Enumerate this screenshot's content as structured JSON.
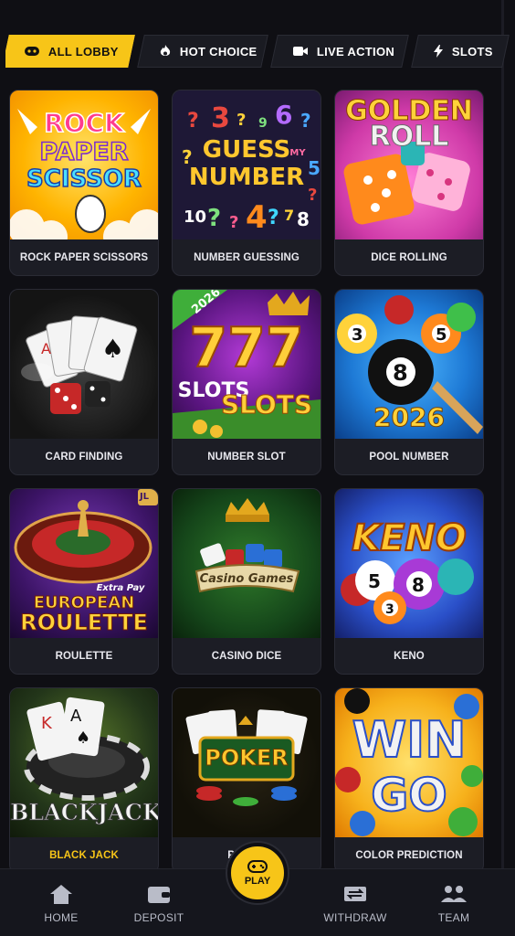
{
  "tabs": [
    {
      "label": "ALL LOBBY",
      "icon": "gamepad-icon",
      "active": true
    },
    {
      "label": "HOT CHOICE",
      "icon": "flame-icon",
      "active": false
    },
    {
      "label": "LIVE ACTION",
      "icon": "video-camera-icon",
      "active": false
    },
    {
      "label": "SLOTS",
      "icon": "lightning-icon",
      "active": false
    }
  ],
  "games": [
    {
      "label": "ROCK PAPER SCISSORS",
      "art": [
        "ROCK",
        "PAPER",
        "SCISSOR"
      ]
    },
    {
      "label": "NUMBER GUESSING",
      "art": [
        "GUESS",
        "NUMBER",
        "MY"
      ]
    },
    {
      "label": "DICE ROLLING",
      "art": [
        "GOLDEN",
        "ROLL"
      ]
    },
    {
      "label": "CARD FINDING",
      "art": []
    },
    {
      "label": "NUMBER SLOT",
      "art": [
        "2026",
        "777",
        "SLOTS",
        "SLOTS"
      ]
    },
    {
      "label": "POOL NUMBER",
      "art": [
        "3",
        "5",
        "8",
        "2026"
      ]
    },
    {
      "label": "ROULETTE",
      "art": [
        "JL",
        "Extra Pay",
        "EUROPEAN",
        "ROULETTE"
      ]
    },
    {
      "label": "CASINO DICE",
      "art": [
        "Casino Games"
      ]
    },
    {
      "label": "KENO",
      "art": [
        "KENO",
        "5",
        "8",
        "3"
      ]
    },
    {
      "label": "BLACK JACK",
      "art": [
        "BLACKJACK"
      ]
    },
    {
      "label": "POKER",
      "art": [
        "POKER"
      ]
    },
    {
      "label": "COLOR PREDICTION",
      "art": [
        "WIN",
        "GO"
      ]
    }
  ],
  "nav": {
    "home": "HOME",
    "deposit": "DEPOSIT",
    "play": "PLAY",
    "withdraw": "WITHDRAW",
    "team": "TEAM"
  },
  "colors": {
    "accent": "#f7c518",
    "background": "#0f0f14",
    "card": "#1c1d25"
  }
}
